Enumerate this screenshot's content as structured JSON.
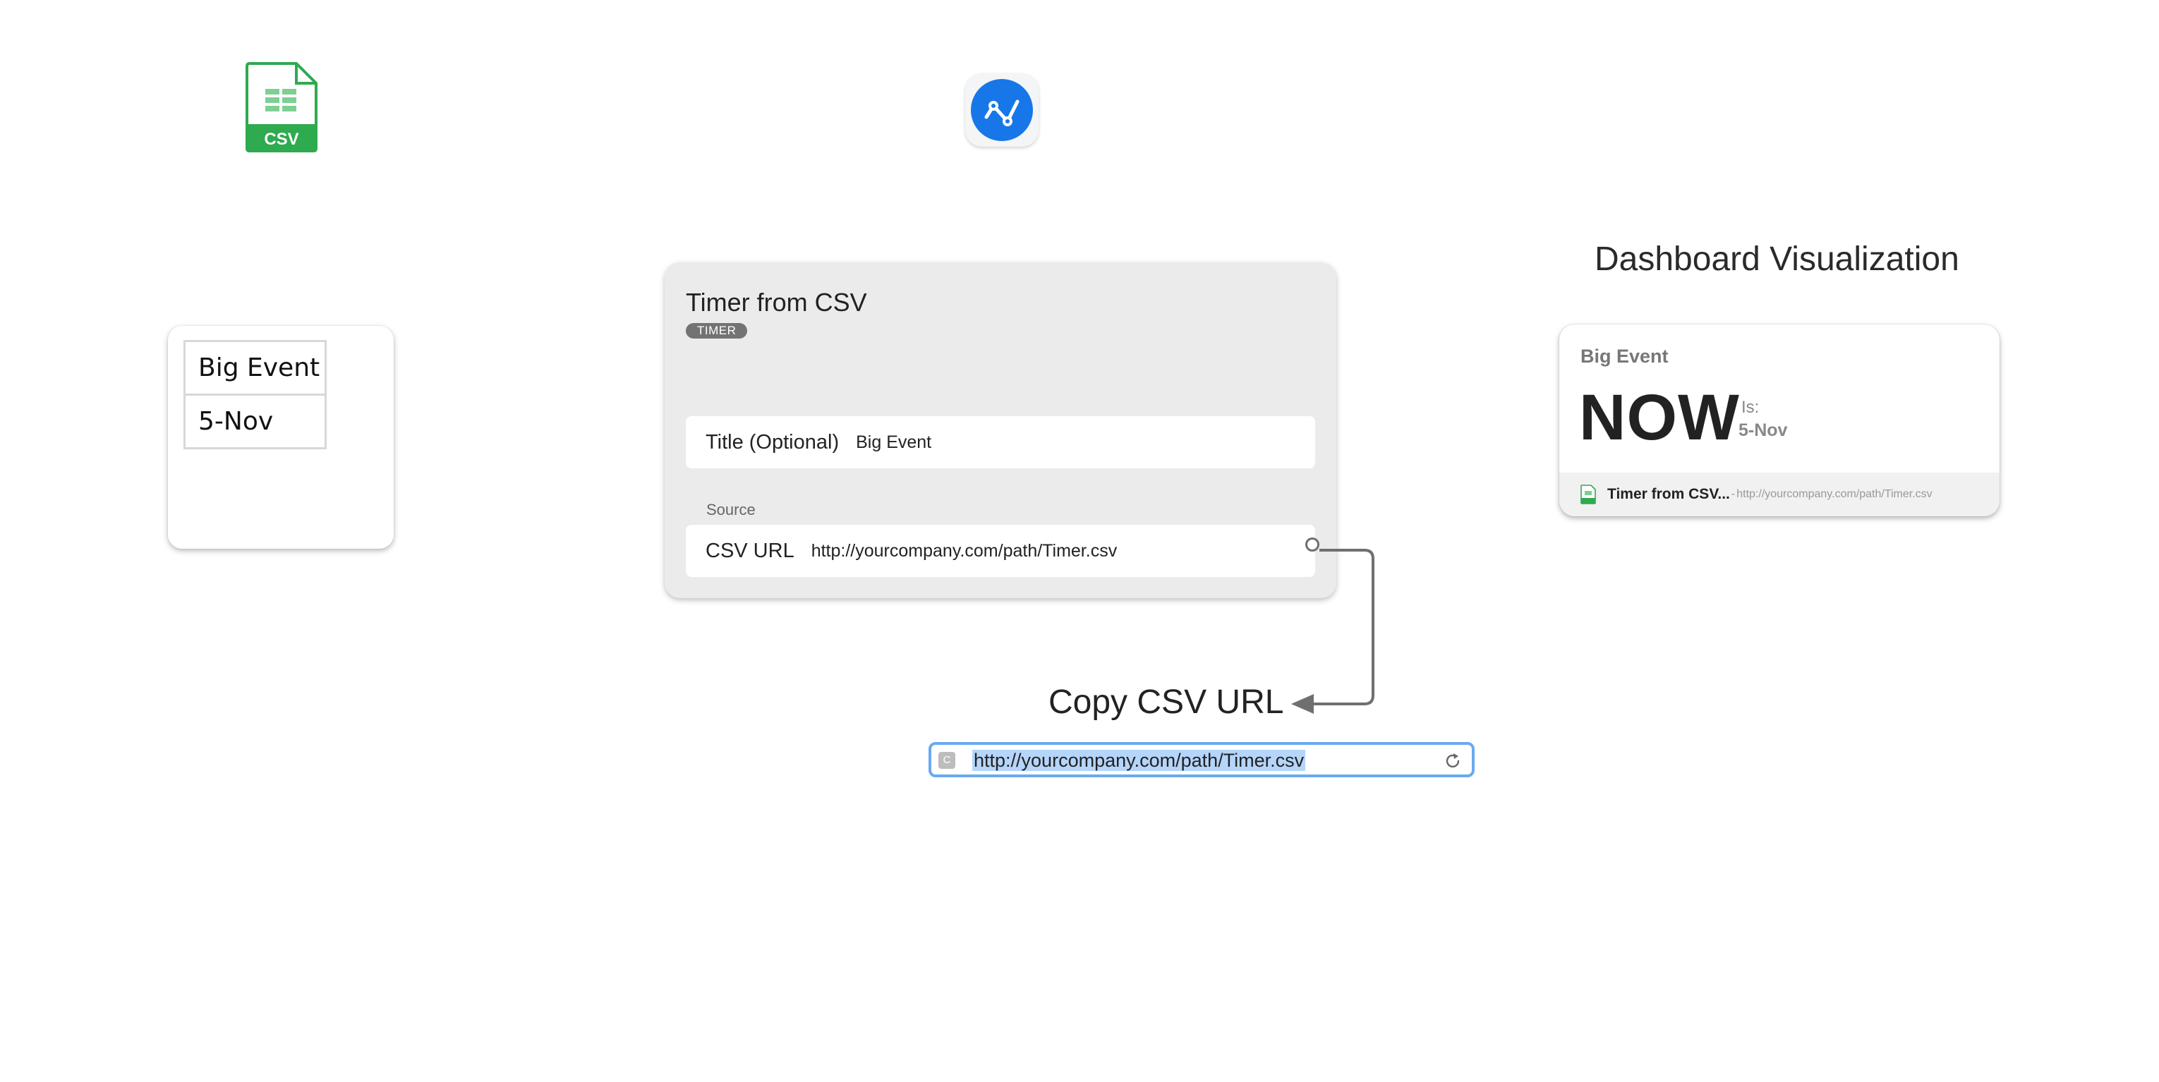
{
  "icons": {
    "csv_file_label": "CSV",
    "csv_color": "#2eaa4f",
    "app_color": "#1877e8"
  },
  "spreadsheet": {
    "rows": [
      "Big Event",
      "5-Nov"
    ]
  },
  "timer_card": {
    "title": "Timer from CSV",
    "badge": "TIMER",
    "title_field": {
      "label": "Title (Optional)",
      "value": "Big Event"
    },
    "source_section_label": "Source",
    "csv_url_field": {
      "label": "CSV URL",
      "value": "http://yourcompany.com/path/Timer.csv"
    }
  },
  "copy_caption": "Copy CSV URL",
  "url_bar": {
    "favicon_letter": "C",
    "url": "http://yourcompany.com/path/Timer.csv",
    "accent": "#6aaaf0"
  },
  "dashboard": {
    "heading": "Dashboard Visualization",
    "event_title": "Big Event",
    "status": "NOW",
    "is_label": "Is:",
    "date": "5-Nov",
    "footer": {
      "source_name": "Timer from CSV...",
      "separator": "-",
      "source_url": "http://yourcompany.com/path/Timer.csv"
    }
  }
}
